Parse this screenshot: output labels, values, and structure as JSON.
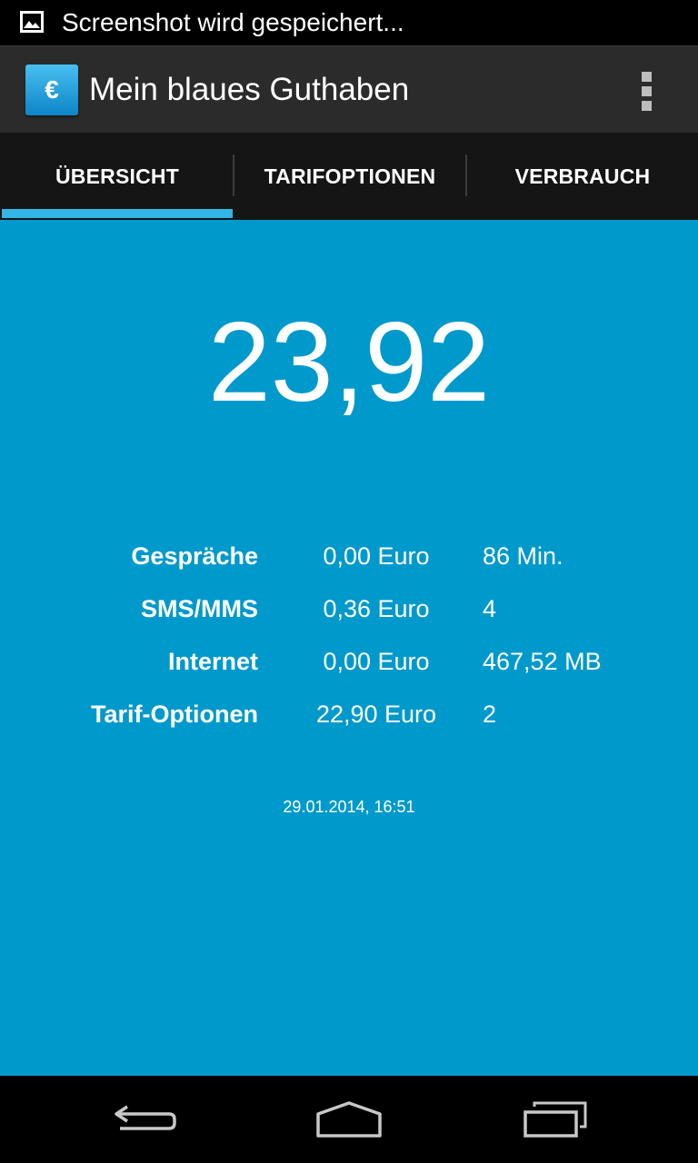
{
  "status_bar": {
    "notification_icon": "image-icon",
    "notification_text": "Screenshot wird gespeichert..."
  },
  "action_bar": {
    "app_icon_symbol": "€",
    "title": "Mein blaues Guthaben",
    "overflow_icon": "more-vert-icon"
  },
  "tabs": [
    {
      "label": "ÜBERSICHT",
      "selected": true
    },
    {
      "label": "TARIFOPTIONEN",
      "selected": false
    },
    {
      "label": "VERBRAUCH",
      "selected": false
    }
  ],
  "balance": "23,92",
  "usage_rows": [
    {
      "label": "Gespräche",
      "amount": "0,00 Euro",
      "quantity": "86 Min."
    },
    {
      "label": "SMS/MMS",
      "amount": "0,36 Euro",
      "quantity": "4"
    },
    {
      "label": "Internet",
      "amount": "0,00 Euro",
      "quantity": "467,52 MB"
    },
    {
      "label": "Tarif-Optionen",
      "amount": "22,90 Euro",
      "quantity": "2"
    }
  ],
  "timestamp": "29.01.2014, 16:51",
  "nav_bar": {
    "back_icon": "back-icon",
    "home_icon": "home-icon",
    "recents_icon": "recent-apps-icon"
  },
  "colors": {
    "accent": "#33b5e5",
    "content_background": "#0099cc",
    "action_bar": "#2b2b2b",
    "tab_bar": "#151515"
  }
}
